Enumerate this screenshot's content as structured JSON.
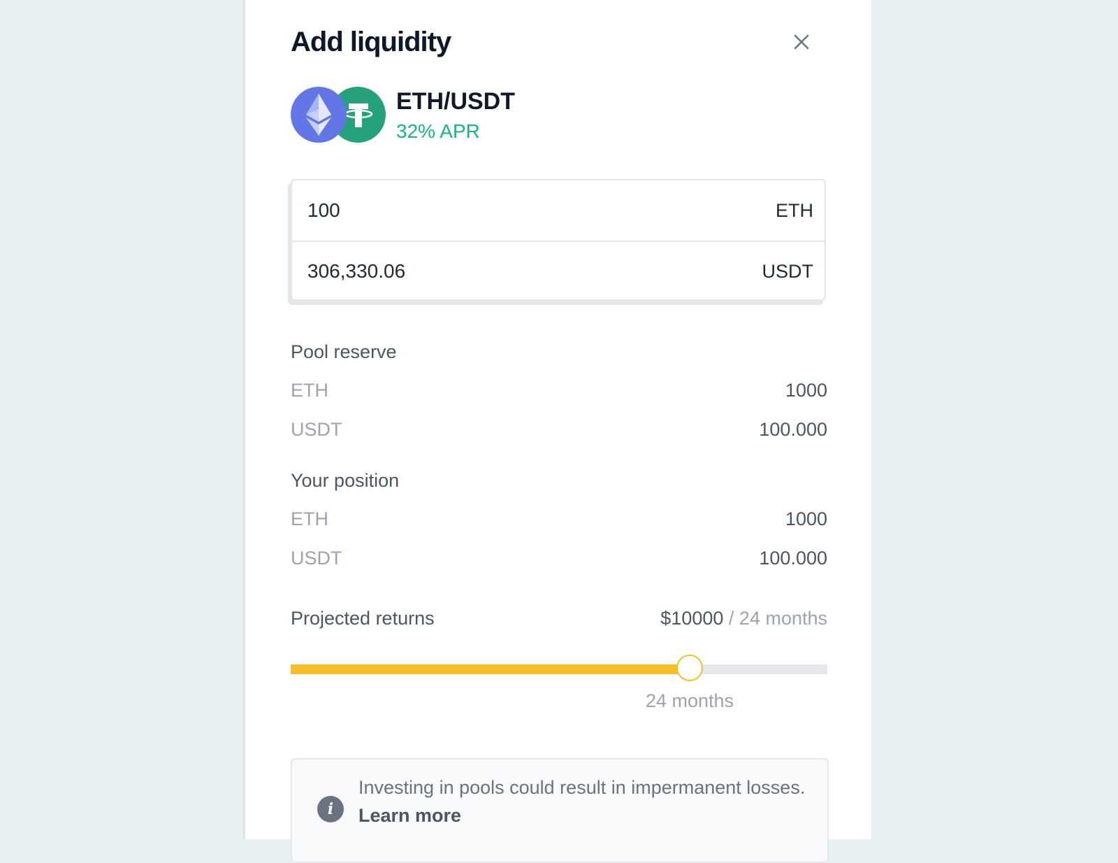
{
  "dialog": {
    "title": "Add liquidity"
  },
  "pool": {
    "pair": "ETH/USDT",
    "apr": "32% APR",
    "tokens": [
      {
        "symbol": "ETH",
        "icon": "ethereum-icon",
        "color": "#6276e6"
      },
      {
        "symbol": "USDT",
        "icon": "tether-icon",
        "color": "#26a17b"
      }
    ]
  },
  "amounts": [
    {
      "value": "100",
      "unit": "ETH"
    },
    {
      "value": "306,330.06",
      "unit": "USDT"
    }
  ],
  "pool_reserve": {
    "title": "Pool reserve",
    "rows": [
      {
        "label": "ETH",
        "value": "1000"
      },
      {
        "label": "USDT",
        "value": "100.000"
      }
    ]
  },
  "your_position": {
    "title": "Your position",
    "rows": [
      {
        "label": "ETH",
        "value": "1000"
      },
      {
        "label": "USDT",
        "value": "100.000"
      }
    ]
  },
  "projected_returns": {
    "label": "Projected returns",
    "amount": "$10000",
    "period": "/ 24 months"
  },
  "duration_slider": {
    "fraction": 0.744,
    "caption": "24 months",
    "color": "#f4bd2a"
  },
  "notice": {
    "text": "Investing in pools could result in impermanent losses.",
    "link": "Learn more"
  }
}
